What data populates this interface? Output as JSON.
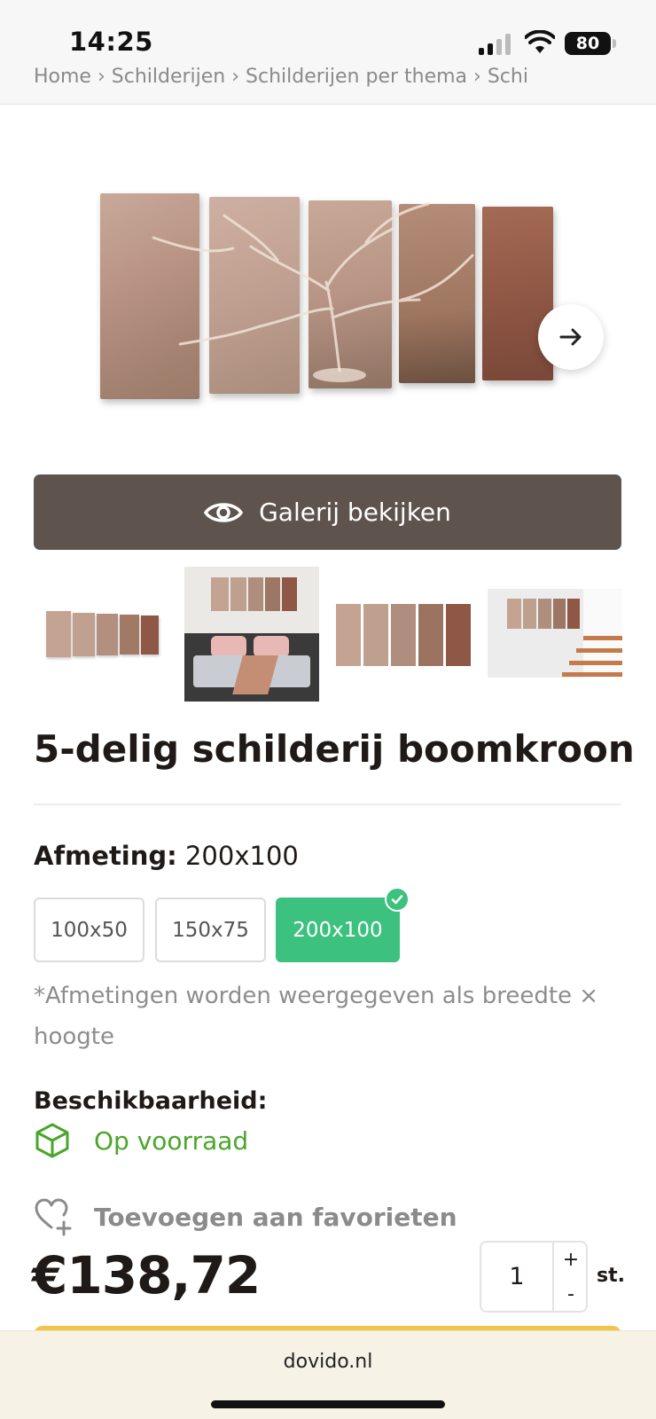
{
  "status_bar": {
    "time": "14:25",
    "battery": "80"
  },
  "breadcrumb": "Home  ›  Schilderijen  ›  Schilderijen per thema  ›  Schi",
  "gallery_button": {
    "label": "Galerij bekijken"
  },
  "product": {
    "title": "5-delig schilderij boomkroon",
    "size_label": "Afmeting:",
    "size_value": "200x100",
    "sizes": [
      "100x50",
      "150x75",
      "200x100"
    ],
    "selected_size": "200x100",
    "size_note": "*Afmetingen worden weergegeven als breedte × hoogte",
    "availability_label": "Beschikbaarheid:",
    "availability_value": "Op voorraad",
    "favorite_label": "Toevoegen aan favorieten",
    "price": "€138,72",
    "quantity": "1",
    "qty_plus": "+",
    "qty_minus": "-",
    "unit": "st."
  },
  "browser": {
    "domain": "dovido.nl"
  },
  "colors": {
    "accent_green": "#3cc27e",
    "stock_green": "#4aa62a",
    "gallery_button": "#5e544d",
    "cart_yellow": "#f4c34a"
  },
  "icons": [
    "eye-icon",
    "arrow-right-icon",
    "check-icon",
    "box-icon",
    "heart-plus-icon",
    "wifi-icon",
    "signal-icon"
  ]
}
